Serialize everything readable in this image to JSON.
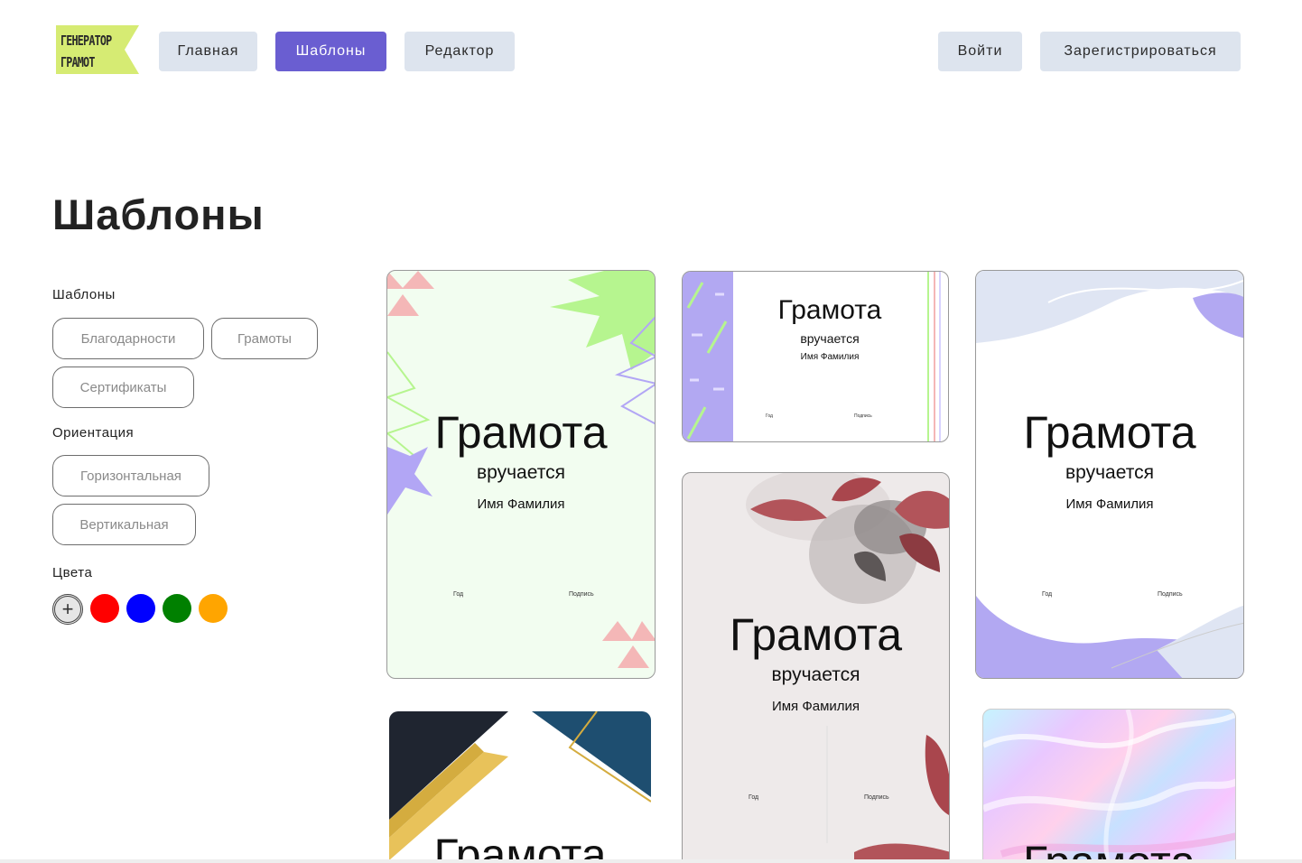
{
  "logo": {
    "text": "ГЕНЕРАТОР\nГРАМОТ",
    "color": "#d6eb73"
  },
  "nav": {
    "home": "Главная",
    "templates": "Шаблоны",
    "editor": "Редактор",
    "login": "Войти",
    "register": "Зарегистрироваться"
  },
  "page_title": "Шаблоны",
  "filters": {
    "templates_label": "Шаблоны",
    "template_types": [
      "Благодарности",
      "Грамоты",
      "Сертификаты"
    ],
    "orientation_label": "Ориентация",
    "orientations": [
      "Горизонтальная",
      "Вертикальная"
    ],
    "colors_label": "Цвета",
    "add_color_icon": "plus-icon",
    "colors": [
      "#ff0000",
      "#0000ff",
      "#008000",
      "#ffa500"
    ]
  },
  "card_text": {
    "title": "Грамота",
    "subtitle": "вручается",
    "name": "Имя Фамилия",
    "year": "Год",
    "signature": "Подпись"
  },
  "accent_color": "#6a5ed1"
}
